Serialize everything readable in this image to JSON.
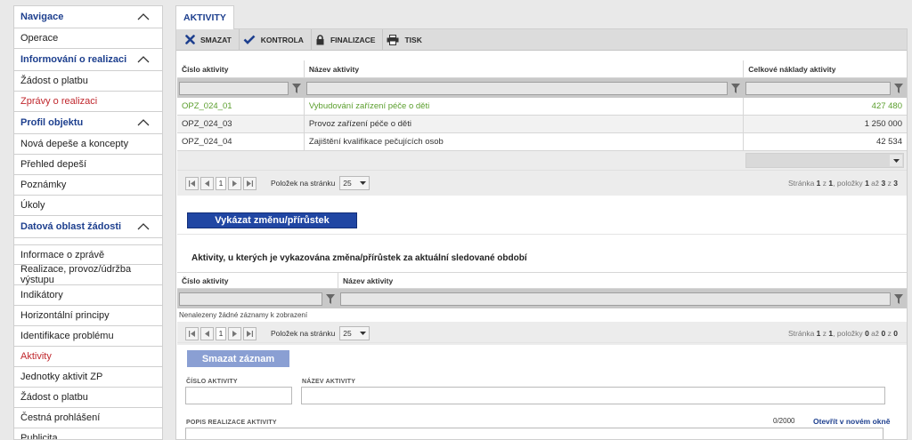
{
  "sidebar": {
    "sections": [
      {
        "title": "Navigace",
        "items": [
          {
            "label": "Operace",
            "active": false
          }
        ]
      },
      {
        "title": "Informování o realizaci",
        "items": [
          {
            "label": "Žádost o platbu",
            "active": false
          },
          {
            "label": "Zprávy o realizaci",
            "active": true
          }
        ]
      },
      {
        "title": "Profil objektu",
        "items": [
          {
            "label": "Nová depeše a koncepty",
            "active": false
          },
          {
            "label": "Přehled depeší",
            "active": false
          },
          {
            "label": "Poznámky",
            "active": false
          },
          {
            "label": "Úkoly",
            "active": false
          }
        ]
      },
      {
        "title": "Datová oblast žádosti",
        "items": [
          {
            "label": "Informace o zprávě",
            "active": false
          },
          {
            "label": "Realizace, provoz/údržba výstupu",
            "active": false
          },
          {
            "label": "Indikátory",
            "active": false
          },
          {
            "label": "Horizontální principy",
            "active": false
          },
          {
            "label": "Identifikace problému",
            "active": false
          },
          {
            "label": "Aktivity",
            "active": true
          },
          {
            "label": "Jednotky aktivit ZP",
            "active": false
          },
          {
            "label": "Žádost o platbu",
            "active": false
          },
          {
            "label": "Čestná prohlášení",
            "active": false
          },
          {
            "label": "Publicita",
            "active": false
          }
        ]
      }
    ]
  },
  "tab": {
    "label": "AKTIVITY"
  },
  "toolbar": {
    "delete_label": "SMAZAT",
    "check_label": "KONTROLA",
    "finalize_label": "FINALIZACE",
    "print_label": "TISK"
  },
  "grid1": {
    "columns": [
      "Číslo aktivity",
      "Název aktivity",
      "Celkové náklady aktivity"
    ],
    "rows": [
      {
        "code": "OPZ_024_01",
        "name": "Vybudování zařízení péče o děti",
        "cost": "427 480"
      },
      {
        "code": "OPZ_024_03",
        "name": "Provoz zařízení péče o děti",
        "cost": "1 250 000"
      },
      {
        "code": "OPZ_024_04",
        "name": "Zajištění kvalifikace pečujících osob",
        "cost": "42 534"
      }
    ],
    "pager": {
      "current_page": "1",
      "per_page_label": "Položek na stránku",
      "per_page_value": "25",
      "info_prefix": "Stránka",
      "page": "1",
      "of_label": "z",
      "pages": "1",
      "items_label": ", položky",
      "from": "1",
      "to_label": "až",
      "to": "3",
      "of2_label": "z",
      "total": "3"
    }
  },
  "report_button": {
    "label": "Vykázat změnu/přírůstek"
  },
  "grid2": {
    "title": "Aktivity, u kterých je vykazována změna/přírůstek za aktuální sledované období",
    "columns": [
      "Číslo aktivity",
      "Název aktivity"
    ],
    "empty_message": "Nenalezeny žádné záznamy k zobrazení",
    "pager": {
      "current_page": "1",
      "per_page_label": "Položek na stránku",
      "per_page_value": "25",
      "info_prefix": "Stránka",
      "page": "1",
      "of_label": "z",
      "pages": "1",
      "items_label": ", položky",
      "from": "0",
      "to_label": "až",
      "to": "0",
      "of2_label": "z",
      "total": "0"
    }
  },
  "delete_record_button": {
    "label": "Smazat záznam"
  },
  "form": {
    "code_label": "ČÍSLO AKTIVITY",
    "name_label": "NÁZEV AKTIVITY",
    "description_label": "POPIS REALIZACE AKTIVITY",
    "counter": "0/2000",
    "open_window_link": "Otevřít v novém okně"
  },
  "colors": {
    "nav_blue": "#1d3f8e",
    "active_red": "#c0272d",
    "green_row": "#5a9e2c",
    "button_blue": "#2046a3"
  }
}
